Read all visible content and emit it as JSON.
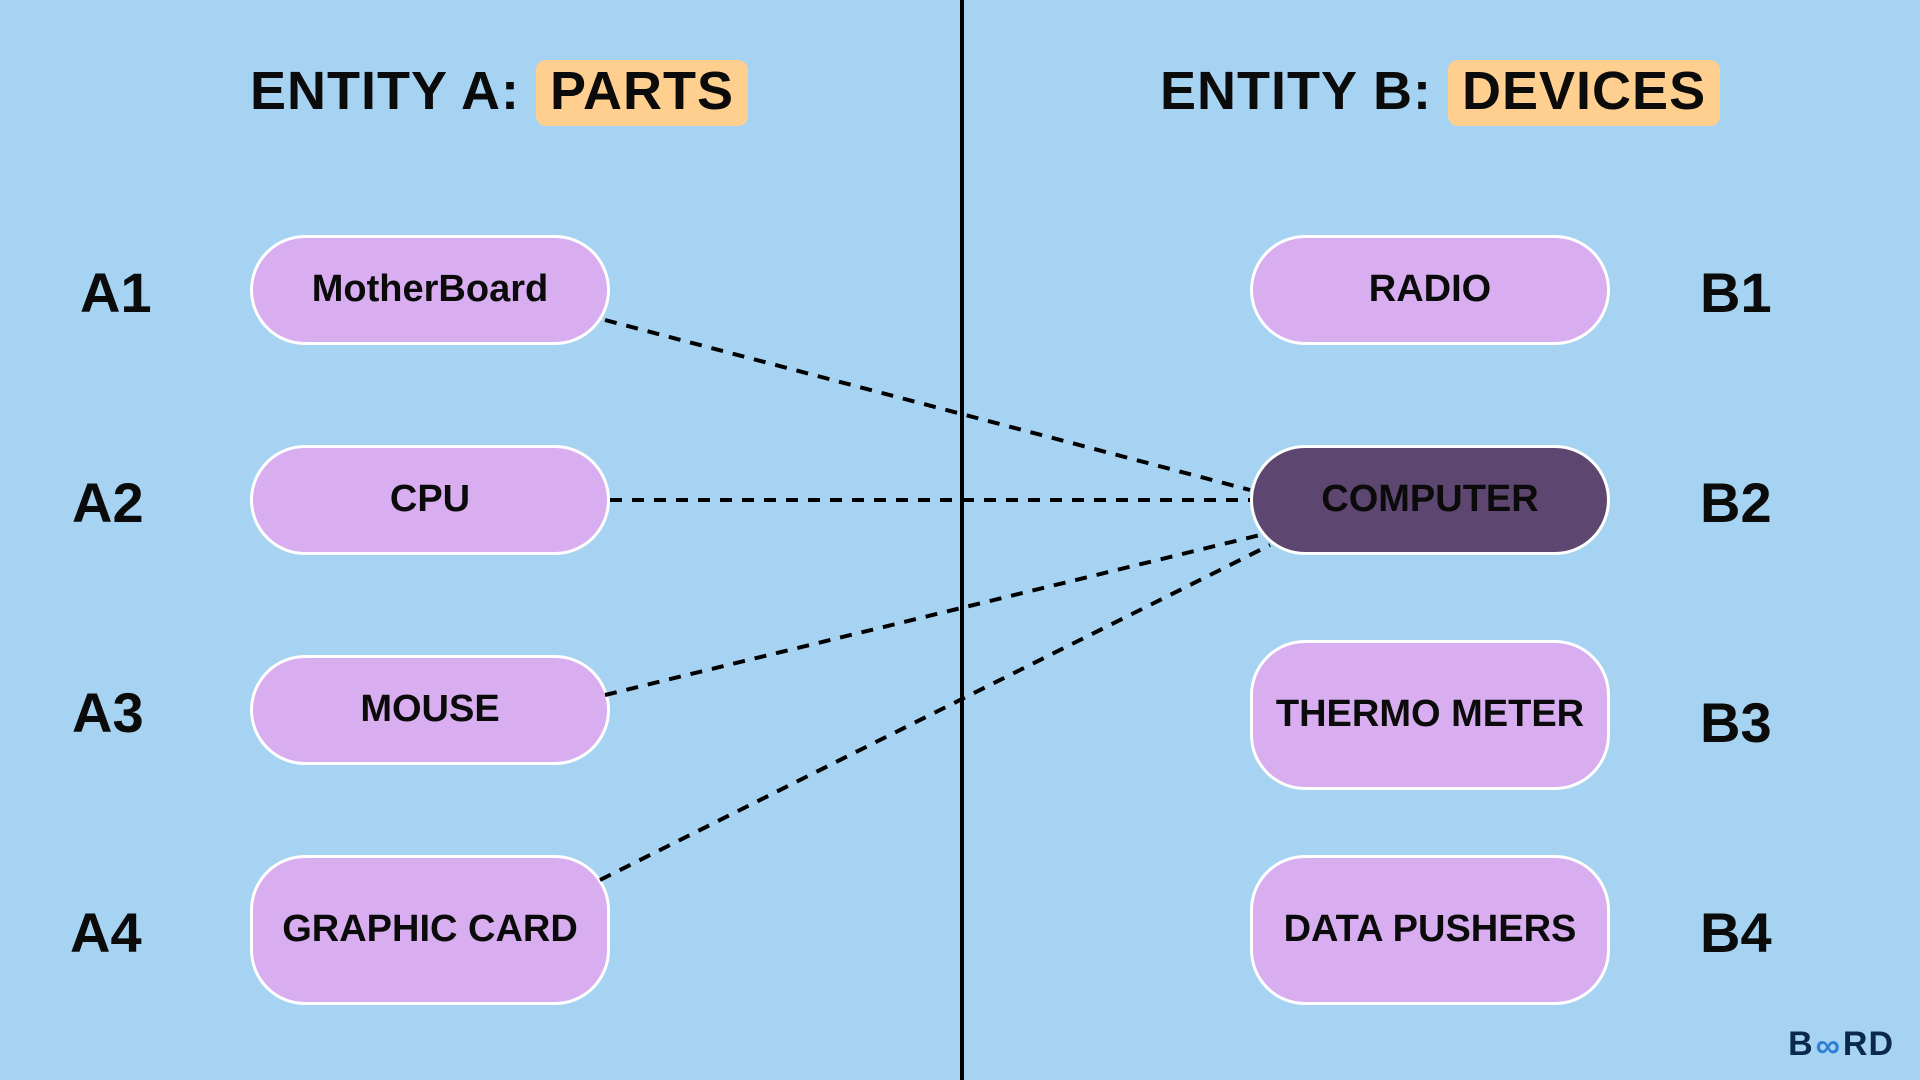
{
  "entity_a": {
    "title_prefix": "ENTITY A: ",
    "title_highlight": "PARTS",
    "items": [
      {
        "id": "A1",
        "label": "MotherBoard"
      },
      {
        "id": "A2",
        "label": "CPU"
      },
      {
        "id": "A3",
        "label": "MOUSE"
      },
      {
        "id": "A4",
        "label": "GRAPHIC CARD"
      }
    ]
  },
  "entity_b": {
    "title_prefix": "ENTITY B: ",
    "title_highlight": "DEVICES",
    "items": [
      {
        "id": "B1",
        "label": "RADIO"
      },
      {
        "id": "B2",
        "label": "COMPUTER",
        "highlighted": true
      },
      {
        "id": "B3",
        "label": "THERMO METER"
      },
      {
        "id": "B4",
        "label": "DATA PUSHERS"
      }
    ]
  },
  "connections": [
    {
      "from": "A1",
      "to": "B2"
    },
    {
      "from": "A2",
      "to": "B2"
    },
    {
      "from": "A3",
      "to": "B2"
    },
    {
      "from": "A4",
      "to": "B2"
    }
  ],
  "colors": {
    "background": "#a7d3f2",
    "pill_light": "#d8aef0",
    "pill_dark": "#5d4770",
    "highlight": "#ffcf8f"
  },
  "brand": {
    "pre": "B",
    "mid": "∞",
    "post": "RD"
  }
}
